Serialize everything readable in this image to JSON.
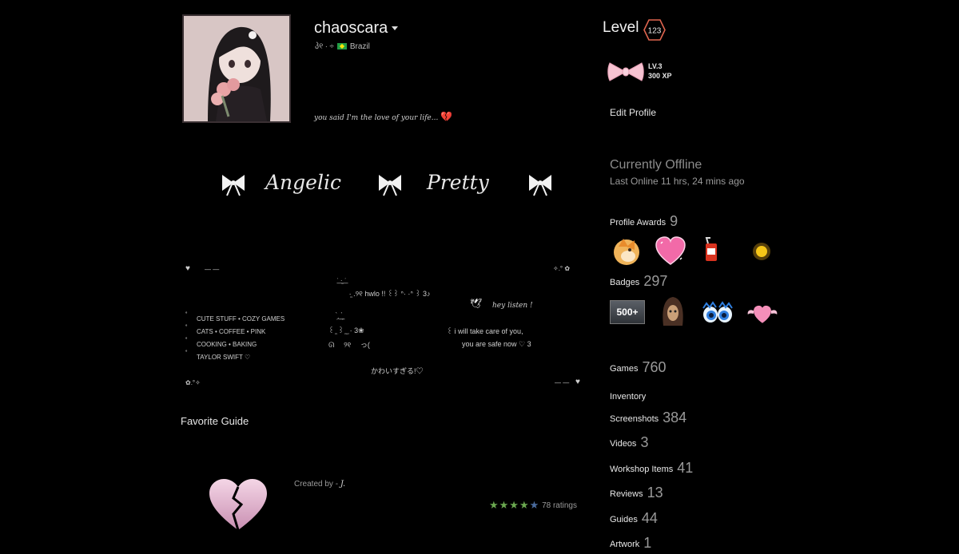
{
  "profile": {
    "username": "chaoscara",
    "location_deco": "პ୧ ‧ ÷",
    "country": "Brazil",
    "summary": "you said I'm the love of your life...",
    "summary_emoji": "💔"
  },
  "banner": {
    "words": [
      "Angelic",
      "Pretty"
    ]
  },
  "showcase": {
    "top_left": "— —",
    "top_right": "✧.° ✿",
    "center_deco1": "ʿ͟ ·̫ ͟ʾ",
    "center_line1": "⠀⠀ ·̫ .୨୧ hwlo !! ꒰꒱ ᐢ· ·ᐢ ꒱ 3♪",
    "center_line2": "⠀ ̗̀, ͟͟ ̗̀",
    "center_line3": "꒰ ̫ ꒱ ̫ ̫ · 3❀",
    "center_line4": "ᘏ ⠀ ୨୧ ⠀ っ(",
    "bird": "🕊",
    "hey_listen": "hey listen !",
    "likes": [
      "CUTE STUFF • COZY GAMES",
      "CATS • COFFEE • PINK",
      "COOKING • BAKING",
      "TAYLOR SWIFT ♡"
    ],
    "bullet": "˚",
    "care_line1": "꒰ i will take care of you,",
    "care_line2": "you are safe now ♡ 3",
    "japanese": "かわいすぎる!♡",
    "bottom_left": "✿.°✧",
    "bottom_right": "— —"
  },
  "favorite_guide": {
    "title": "Favorite Guide",
    "created_by_label": "Created by -",
    "author": "J.",
    "ratings": "78 ratings",
    "stars_filled": 4,
    "stars_total": 5
  },
  "sidebar": {
    "level_label": "Level",
    "level_value": "123",
    "badge_level": "LV.3",
    "badge_xp": "300 XP",
    "edit_profile": "Edit Profile",
    "status": "Currently Offline",
    "last_online": "Last Online 11 hrs, 24 mins ago",
    "profile_awards_label": "Profile Awards",
    "profile_awards_count": "9",
    "badges_label": "Badges",
    "badges_count": "297",
    "badge_500": "500+",
    "stats": [
      {
        "label": "Games",
        "count": "760"
      },
      {
        "label": "Inventory",
        "count": ""
      },
      {
        "label": "Screenshots",
        "count": "384"
      },
      {
        "label": "Videos",
        "count": "3"
      },
      {
        "label": "Workshop Items",
        "count": "41"
      },
      {
        "label": "Reviews",
        "count": "13"
      },
      {
        "label": "Guides",
        "count": "44"
      },
      {
        "label": "Artwork",
        "count": "1"
      }
    ]
  },
  "colors": {
    "background": "#000000",
    "pink": "#f3a7c6",
    "star_green": "#6aa84f",
    "level_hex": "#e0654f"
  }
}
